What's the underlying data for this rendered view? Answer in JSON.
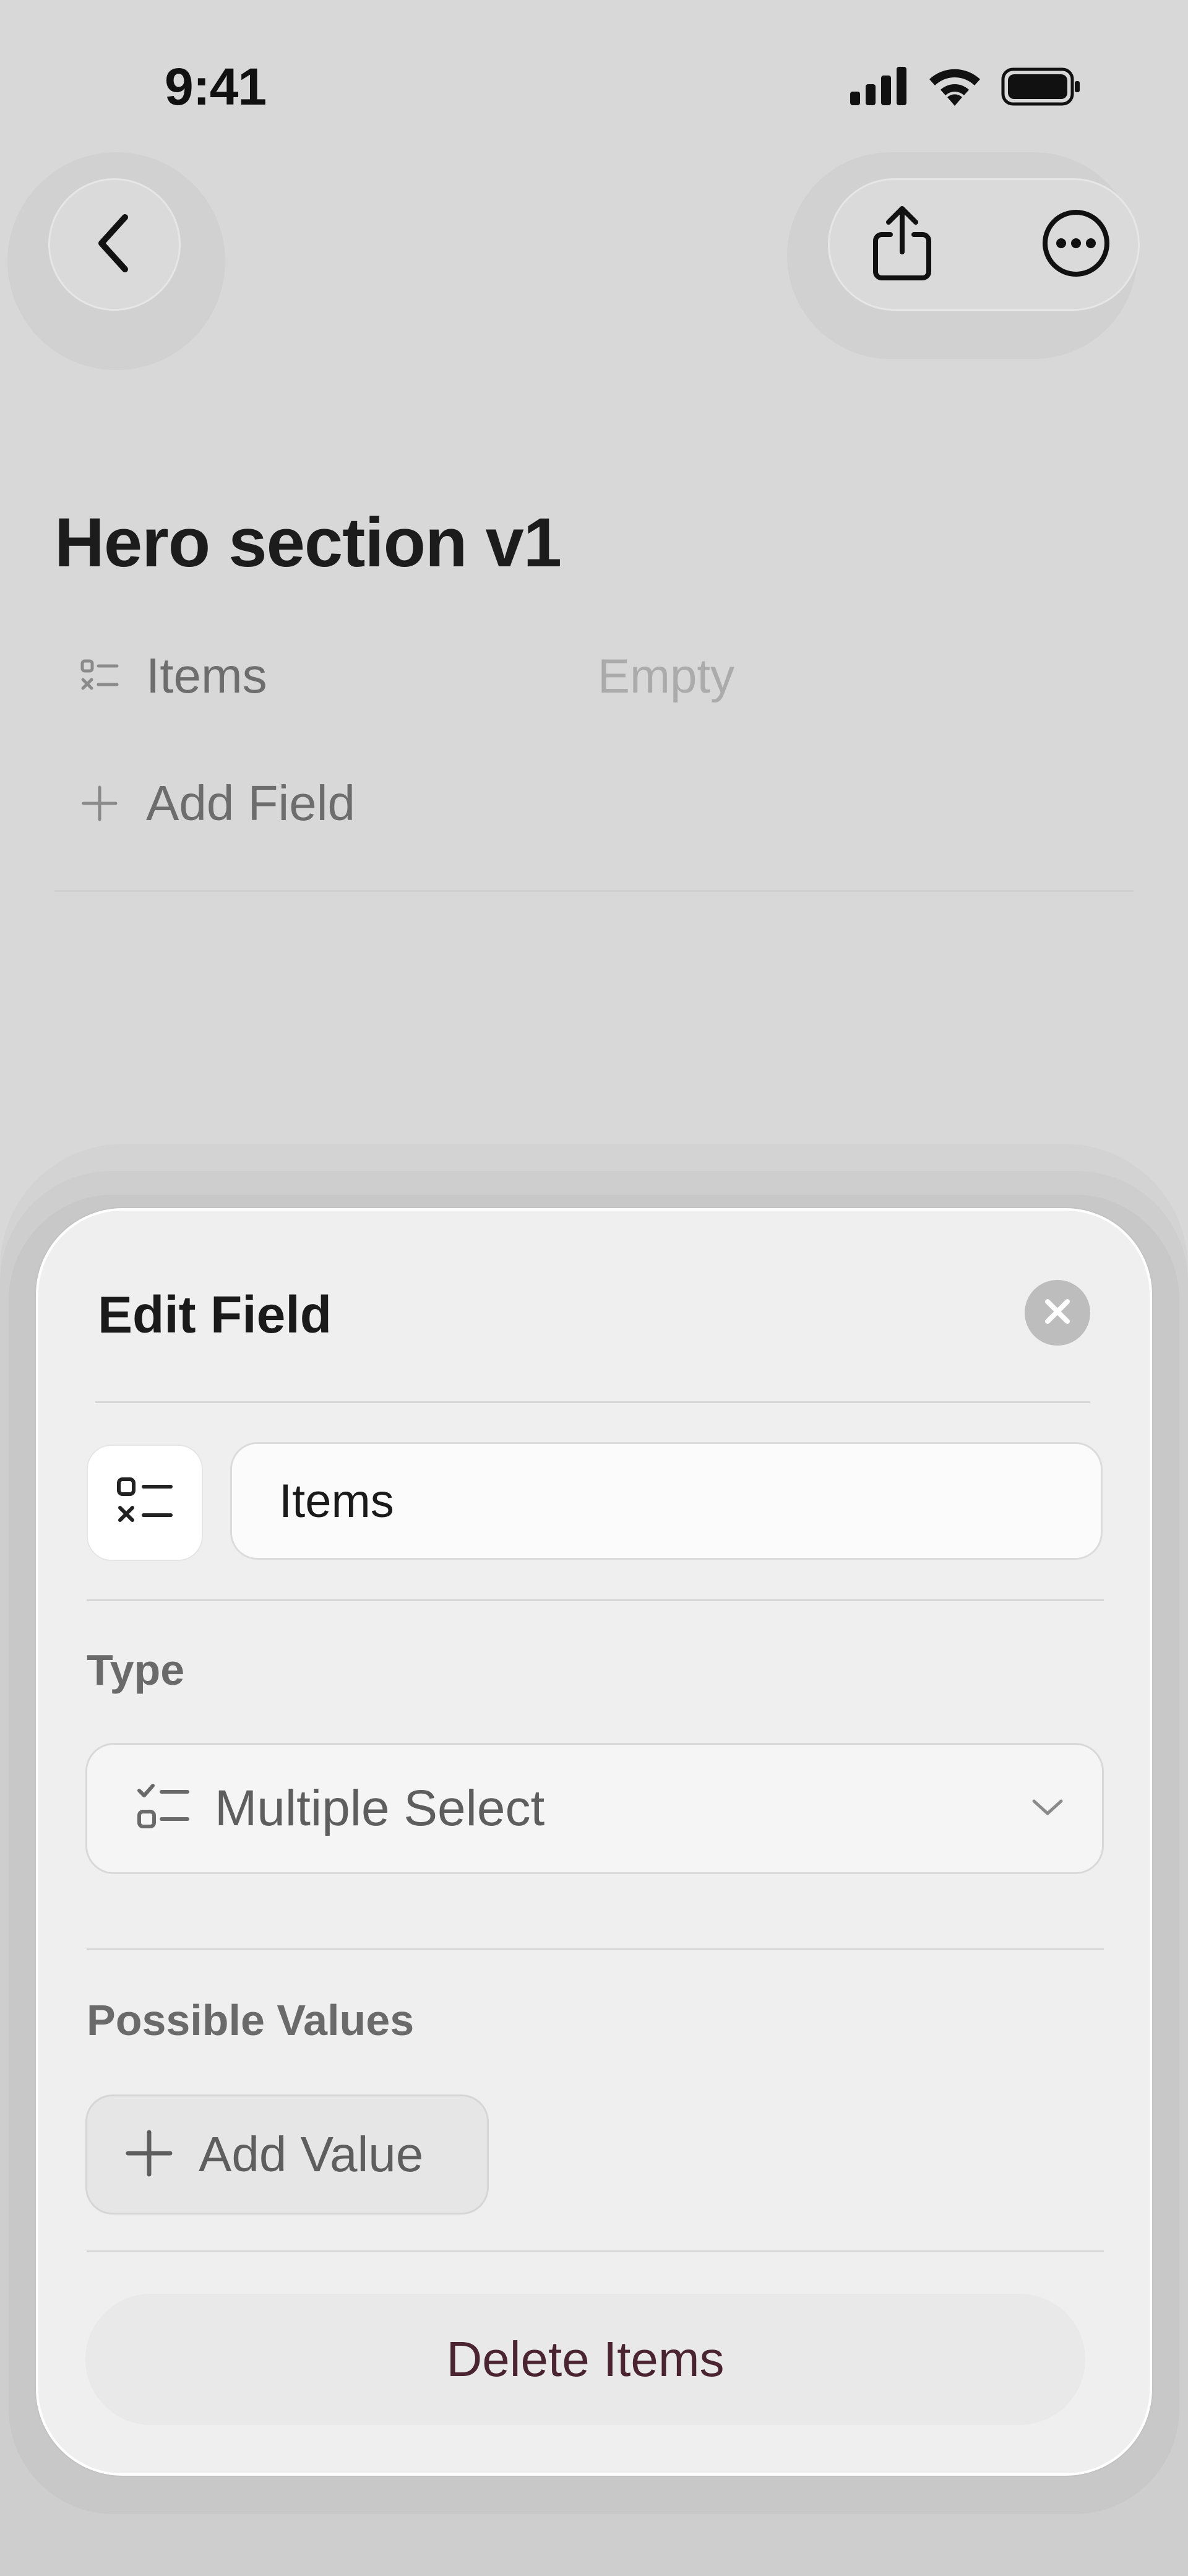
{
  "status_bar": {
    "time": "9:41"
  },
  "page": {
    "title": "Hero section v1"
  },
  "properties": [
    {
      "label": "Items",
      "value": "Empty",
      "icon": "checklist-icon"
    },
    {
      "label": "Add Field",
      "icon": "plus-icon"
    }
  ],
  "sheet": {
    "title": "Edit Field",
    "field_name_value": "Items",
    "type_section_label": "Type",
    "type_value": "Multiple Select",
    "possible_values_label": "Possible Values",
    "add_value_label": "Add Value",
    "delete_label": "Delete Items"
  },
  "colors": {
    "background": "#d8d8d8",
    "sheet": "#efefef",
    "delete_text": "#4a2430"
  }
}
